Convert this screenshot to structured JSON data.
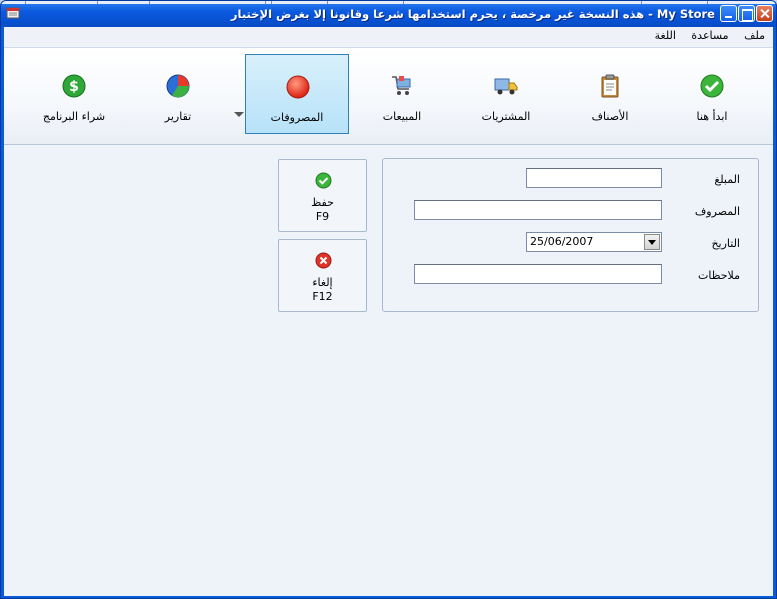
{
  "window": {
    "title": "My Store - هذه النسخة غير مرخصة ، يحرم استخدامها شرعا وقانونا إلا بغرض الإختبار"
  },
  "menu": {
    "items": [
      "ملف",
      "مساعدة",
      "اللغة"
    ]
  },
  "ribbon": {
    "buttons": [
      {
        "label": "ابدأ هنا",
        "icon": "green-check-icon"
      },
      {
        "label": "الأصناف",
        "icon": "clipboard-icon"
      },
      {
        "label": "المشتريات",
        "icon": "delivery-truck-icon"
      },
      {
        "label": "المبيعات",
        "icon": "shopping-cart-icon"
      },
      {
        "label": "المصروفات",
        "icon": "red-circle-icon"
      },
      {
        "label": "تقارير",
        "icon": "pie-chart-icon"
      },
      {
        "label": "شراء البرنامج",
        "icon": "dollar-coin-icon"
      }
    ],
    "active": "المصروفات"
  },
  "form": {
    "amount_label": "المبلغ",
    "amount_value": "",
    "expense_label": "المصروف",
    "expense_value": "",
    "date_label": "التاريخ",
    "date_value": "25/06/2007",
    "notes_label": "ملاحظات",
    "notes_value": ""
  },
  "actions": {
    "save_label": "حفظ",
    "save_key": "F9",
    "cancel_label": "إلغاء",
    "cancel_key": "F12"
  },
  "colors": {
    "title_bar": "#0a5bd8",
    "active_tab": "#b7e2f8",
    "client_bg": "#eef3fa"
  }
}
